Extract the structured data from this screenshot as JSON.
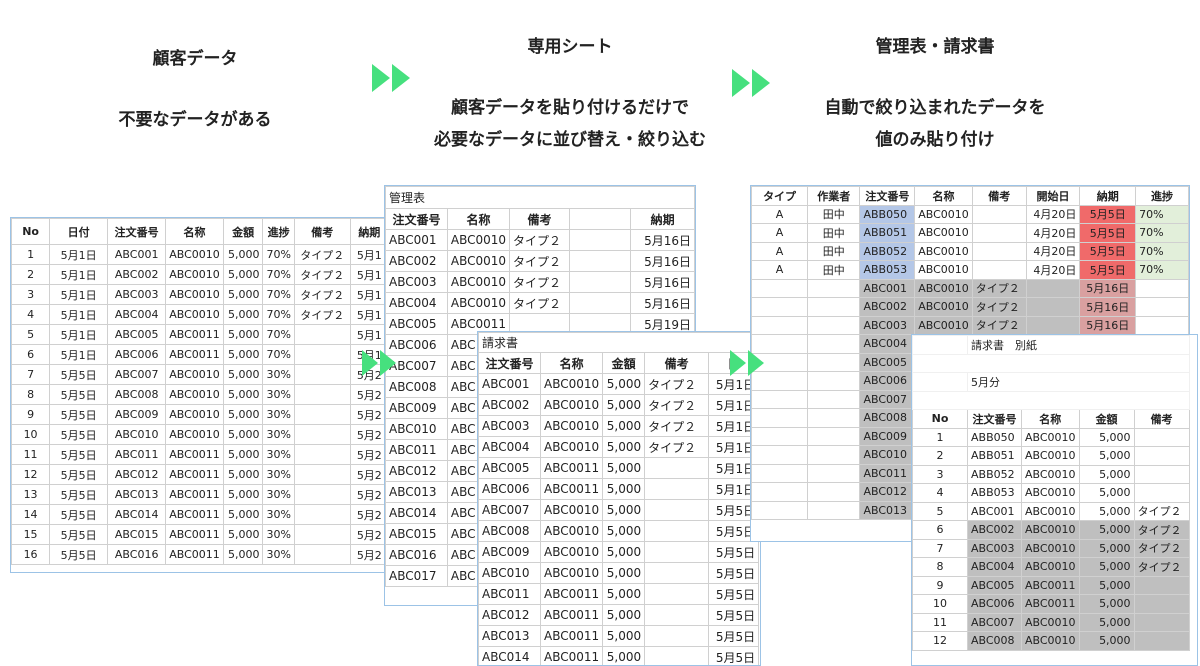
{
  "captions": {
    "col1": [
      "顧客データ",
      "不要なデータがある"
    ],
    "col2": [
      "専用シート",
      "顧客データを貼り付けるだけで",
      "必要なデータに並び替え・絞り込む"
    ],
    "col3": [
      "管理表・請求書",
      "自動で絞り込まれたデータを",
      "値のみ貼り付け"
    ]
  },
  "customer_sheet": {
    "headers": [
      "No",
      "日付",
      "注文番号",
      "名称",
      "金額",
      "進捗",
      "備考",
      "納期"
    ],
    "rows": [
      [
        "1",
        "5月1日",
        "ABC001",
        "ABC0010",
        "5,000",
        "70%",
        "タイプ２",
        "5月1"
      ],
      [
        "2",
        "5月1日",
        "ABC002",
        "ABC0010",
        "5,000",
        "70%",
        "タイプ２",
        "5月1"
      ],
      [
        "3",
        "5月1日",
        "ABC003",
        "ABC0010",
        "5,000",
        "70%",
        "タイプ２",
        "5月1"
      ],
      [
        "4",
        "5月1日",
        "ABC004",
        "ABC0010",
        "5,000",
        "70%",
        "タイプ２",
        "5月1"
      ],
      [
        "5",
        "5月1日",
        "ABC005",
        "ABC0011",
        "5,000",
        "70%",
        "",
        "5月1"
      ],
      [
        "6",
        "5月1日",
        "ABC006",
        "ABC0011",
        "5,000",
        "70%",
        "",
        "5月1"
      ],
      [
        "7",
        "5月5日",
        "ABC007",
        "ABC0010",
        "5,000",
        "30%",
        "",
        "5月2"
      ],
      [
        "8",
        "5月5日",
        "ABC008",
        "ABC0010",
        "5,000",
        "30%",
        "",
        "5月2"
      ],
      [
        "9",
        "5月5日",
        "ABC009",
        "ABC0010",
        "5,000",
        "30%",
        "",
        "5月2"
      ],
      [
        "10",
        "5月5日",
        "ABC010",
        "ABC0010",
        "5,000",
        "30%",
        "",
        "5月2"
      ],
      [
        "11",
        "5月5日",
        "ABC011",
        "ABC0011",
        "5,000",
        "30%",
        "",
        "5月2"
      ],
      [
        "12",
        "5月5日",
        "ABC012",
        "ABC0011",
        "5,000",
        "30%",
        "",
        "5月2"
      ],
      [
        "13",
        "5月5日",
        "ABC013",
        "ABC0011",
        "5,000",
        "30%",
        "",
        "5月2"
      ],
      [
        "14",
        "5月5日",
        "ABC014",
        "ABC0011",
        "5,000",
        "30%",
        "",
        "5月2"
      ],
      [
        "15",
        "5月5日",
        "ABC015",
        "ABC0011",
        "5,000",
        "30%",
        "",
        "5月2"
      ],
      [
        "16",
        "5月5日",
        "ABC016",
        "ABC0011",
        "5,000",
        "30%",
        "",
        "5月2"
      ]
    ]
  },
  "kanri_sheet": {
    "title": "管理表",
    "headers": [
      "注文番号",
      "名称",
      "備考",
      "",
      "納期"
    ],
    "rows": [
      [
        "ABC001",
        "ABC0010",
        "タイプ２",
        "",
        "5月16日"
      ],
      [
        "ABC002",
        "ABC0010",
        "タイプ２",
        "",
        "5月16日"
      ],
      [
        "ABC003",
        "ABC0010",
        "タイプ２",
        "",
        "5月16日"
      ],
      [
        "ABC004",
        "ABC0010",
        "タイプ２",
        "",
        "5月16日"
      ],
      [
        "ABC005",
        "ABC0011",
        "",
        "",
        "5月19日"
      ],
      [
        "ABC006",
        "ABC",
        "",
        "",
        ""
      ],
      [
        "ABC007",
        "ABC",
        "",
        "",
        ""
      ],
      [
        "ABC008",
        "ABC",
        "",
        "",
        ""
      ],
      [
        "ABC009",
        "ABC",
        "",
        "",
        ""
      ],
      [
        "ABC010",
        "ABC",
        "",
        "",
        ""
      ],
      [
        "ABC011",
        "ABC",
        "",
        "",
        ""
      ],
      [
        "ABC012",
        "ABC",
        "",
        "",
        ""
      ],
      [
        "ABC013",
        "ABC",
        "",
        "",
        ""
      ],
      [
        "ABC014",
        "ABC",
        "",
        "",
        ""
      ],
      [
        "ABC015",
        "ABC",
        "",
        "",
        ""
      ],
      [
        "ABC016",
        "ABC",
        "",
        "",
        ""
      ],
      [
        "ABC017",
        "ABC",
        "",
        "",
        ""
      ]
    ]
  },
  "seikyu_sheet": {
    "title": "請求書",
    "headers": [
      "注文番号",
      "名称",
      "金額",
      "備考",
      "日"
    ],
    "rows": [
      [
        "ABC001",
        "ABC0010",
        "5,000",
        "タイプ２",
        "5月1日"
      ],
      [
        "ABC002",
        "ABC0010",
        "5,000",
        "タイプ２",
        "5月1日"
      ],
      [
        "ABC003",
        "ABC0010",
        "5,000",
        "タイプ２",
        "5月1日"
      ],
      [
        "ABC004",
        "ABC0010",
        "5,000",
        "タイプ２",
        "5月1日"
      ],
      [
        "ABC005",
        "ABC0011",
        "5,000",
        "",
        "5月1日"
      ],
      [
        "ABC006",
        "ABC0011",
        "5,000",
        "",
        "5月1日"
      ],
      [
        "ABC007",
        "ABC0010",
        "5,000",
        "",
        "5月5日"
      ],
      [
        "ABC008",
        "ABC0010",
        "5,000",
        "",
        "5月5日"
      ],
      [
        "ABC009",
        "ABC0010",
        "5,000",
        "",
        "5月5日"
      ],
      [
        "ABC010",
        "ABC0010",
        "5,000",
        "",
        "5月5日"
      ],
      [
        "ABC011",
        "ABC0011",
        "5,000",
        "",
        "5月5日"
      ],
      [
        "ABC012",
        "ABC0011",
        "5,000",
        "",
        "5月5日"
      ],
      [
        "ABC013",
        "ABC0011",
        "5,000",
        "",
        "5月5日"
      ],
      [
        "ABC014",
        "ABC0011",
        "5,000",
        "",
        "5月5日"
      ]
    ]
  },
  "filtered_kanri": {
    "headers": [
      "タイプ",
      "作業者",
      "注文番号",
      "名称",
      "備考",
      "開始日",
      "納期",
      "進捗"
    ],
    "rows": [
      [
        "A",
        "田中",
        "ABB050",
        "ABC0010",
        "",
        "4月20日",
        "5月5日",
        "70%"
      ],
      [
        "A",
        "田中",
        "ABB051",
        "ABC0010",
        "",
        "4月20日",
        "5月5日",
        "70%"
      ],
      [
        "A",
        "田中",
        "ABB052",
        "ABC0010",
        "",
        "4月20日",
        "5月5日",
        "70%"
      ],
      [
        "A",
        "田中",
        "ABB053",
        "ABC0010",
        "",
        "4月20日",
        "5月5日",
        "70%"
      ],
      [
        "",
        "",
        "ABC001",
        "ABC0010",
        "タイプ２",
        "",
        "5月16日",
        ""
      ],
      [
        "",
        "",
        "ABC002",
        "ABC0010",
        "タイプ２",
        "",
        "5月16日",
        ""
      ],
      [
        "",
        "",
        "ABC003",
        "ABC0010",
        "タイプ２",
        "",
        "5月16日",
        ""
      ],
      [
        "",
        "",
        "ABC004",
        "",
        "",
        "",
        "",
        ""
      ],
      [
        "",
        "",
        "ABC005",
        "",
        "",
        "",
        "",
        ""
      ],
      [
        "",
        "",
        "ABC006",
        "",
        "",
        "",
        "",
        ""
      ],
      [
        "",
        "",
        "ABC007",
        "",
        "",
        "",
        "",
        ""
      ],
      [
        "",
        "",
        "ABC008",
        "",
        "",
        "",
        "",
        ""
      ],
      [
        "",
        "",
        "ABC009",
        "",
        "",
        "",
        "",
        ""
      ],
      [
        "",
        "",
        "ABC010",
        "",
        "",
        "",
        "",
        ""
      ],
      [
        "",
        "",
        "ABC011",
        "",
        "",
        "",
        "",
        ""
      ],
      [
        "",
        "",
        "ABC012",
        "",
        "",
        "",
        "",
        ""
      ],
      [
        "",
        "",
        "ABC013",
        "",
        "",
        "",
        "",
        ""
      ]
    ]
  },
  "seikyu_bessi": {
    "title": "請求書　別紙",
    "month": "5月分",
    "headers": [
      "No",
      "注文番号",
      "名称",
      "金額",
      "備考"
    ],
    "rows": [
      [
        "1",
        "ABB050",
        "ABC0010",
        "5,000",
        ""
      ],
      [
        "2",
        "ABB051",
        "ABC0010",
        "5,000",
        ""
      ],
      [
        "3",
        "ABB052",
        "ABC0010",
        "5,000",
        ""
      ],
      [
        "4",
        "ABB053",
        "ABC0010",
        "5,000",
        ""
      ],
      [
        "5",
        "ABC001",
        "ABC0010",
        "5,000",
        "タイプ２"
      ],
      [
        "6",
        "ABC002",
        "ABC0010",
        "5,000",
        "タイプ２"
      ],
      [
        "7",
        "ABC003",
        "ABC0010",
        "5,000",
        "タイプ２"
      ],
      [
        "8",
        "ABC004",
        "ABC0010",
        "5,000",
        "タイプ２"
      ],
      [
        "9",
        "ABC005",
        "ABC0011",
        "5,000",
        ""
      ],
      [
        "10",
        "ABC006",
        "ABC0011",
        "5,000",
        ""
      ],
      [
        "11",
        "ABC007",
        "ABC0010",
        "5,000",
        ""
      ],
      [
        "12",
        "ABC008",
        "ABC0010",
        "5,000",
        ""
      ]
    ]
  },
  "colors": {
    "arrow": "#46e07e",
    "highlight_blue": "#b4c7e7",
    "highlight_red": "#f06a6a",
    "highlight_green": "#e2efda",
    "highlight_gray": "#bfbfbf"
  }
}
